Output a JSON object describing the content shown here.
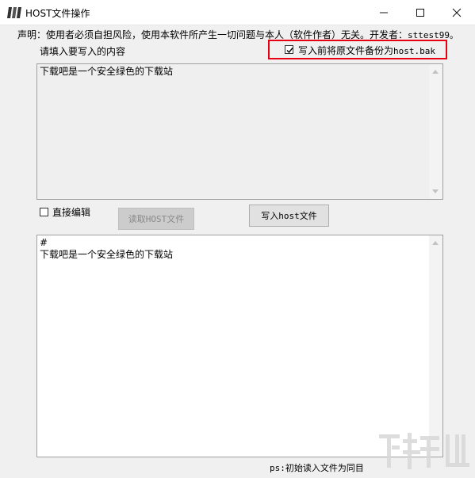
{
  "window": {
    "title": "HOST文件操作",
    "minimize_glyph": "—",
    "maximize_glyph": "☐",
    "close_glyph": "✕"
  },
  "notice": {
    "text": "声明：使用者必须自担风险，使用本软件所产生一切问题与本人（软件作者）无关。开发者：",
    "developer": "sttest99。"
  },
  "prompt_label": "请填入要写入的内容",
  "backup_option": {
    "label_prefix": "写入前将原文件备份为",
    "filename": "host.bak",
    "checked": true
  },
  "input_area": {
    "content": "下载吧是一个安全绿色的下载站"
  },
  "direct_edit": {
    "label": "直接编辑",
    "checked": false
  },
  "buttons": {
    "read_host": "读取HOST文件",
    "write_host": "写入host文件"
  },
  "host_content": {
    "content": "#\n下载吧是一个安全绿色的下载站"
  },
  "status": {
    "text": "ps:初始读入文件为同目"
  },
  "icons": {
    "app": "app-logo-icon",
    "check": "check-icon",
    "annotation": "red-arrow-icon",
    "watermark": "xiazaiba-watermark-logo"
  },
  "colors": {
    "highlight": "#e60012",
    "disabled_text": "#8a8a8a"
  }
}
